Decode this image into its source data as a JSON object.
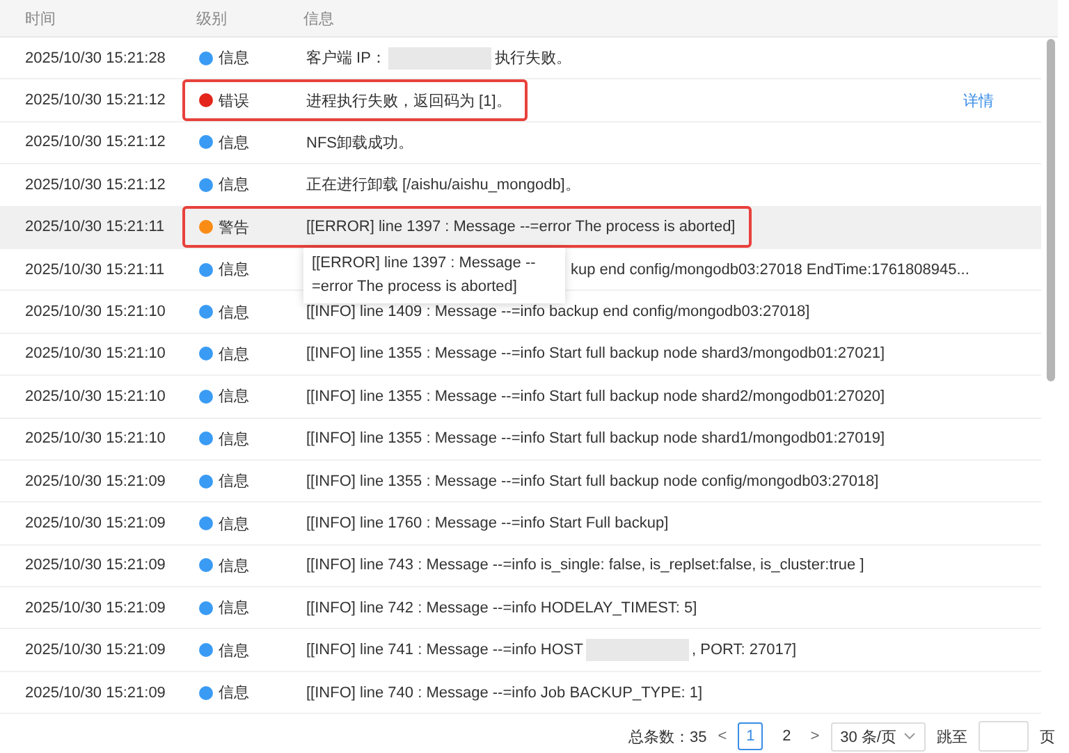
{
  "table": {
    "columns": [
      "时间",
      "级别",
      "信息"
    ],
    "rows": [
      {
        "time": "2025/10/30 15:21:28",
        "level": "信息",
        "kind": "info",
        "message": "客户端 IP：",
        "redacted": true,
        "message_after": "执行失败。",
        "highlighted": false,
        "hovered": false
      },
      {
        "time": "2025/10/30 15:21:12",
        "level": "错误",
        "kind": "error",
        "message": "进程执行失败，返回码为 [1]。",
        "highlighted": true,
        "hovered": false,
        "link": "详情"
      },
      {
        "time": "2025/10/30 15:21:12",
        "level": "信息",
        "kind": "info",
        "message": "NFS卸载成功。",
        "highlighted": false,
        "hovered": false
      },
      {
        "time": "2025/10/30 15:21:12",
        "level": "信息",
        "kind": "info",
        "message": "正在进行卸载 [/aishu/aishu_mongodb]。",
        "highlighted": false,
        "hovered": false
      },
      {
        "time": "2025/10/30 15:21:11",
        "level": "警告",
        "kind": "warning",
        "message": "[[ERROR] line 1397 : Message --=error The process is aborted]",
        "highlighted": true,
        "hovered": true
      },
      {
        "time": "2025/10/30 15:21:11",
        "level": "信息",
        "kind": "info",
        "message": "kup end config/mongodb03:27018 EndTime:1761808945...",
        "covered": true,
        "highlighted": false,
        "hovered": false
      },
      {
        "time": "2025/10/30 15:21:10",
        "level": "信息",
        "kind": "info",
        "message": "[[INFO] line 1409 : Message --=info backup end config/mongodb03:27018]",
        "highlighted": false,
        "hovered": false
      },
      {
        "time": "2025/10/30 15:21:10",
        "level": "信息",
        "kind": "info",
        "message": "[[INFO] line 1355 : Message --=info Start full backup node shard3/mongodb01:27021]",
        "highlighted": false,
        "hovered": false
      },
      {
        "time": "2025/10/30 15:21:10",
        "level": "信息",
        "kind": "info",
        "message": "[[INFO] line 1355 : Message --=info Start full backup node shard2/mongodb01:27020]",
        "highlighted": false,
        "hovered": false
      },
      {
        "time": "2025/10/30 15:21:10",
        "level": "信息",
        "kind": "info",
        "message": "[[INFO] line 1355 : Message --=info Start full backup node shard1/mongodb01:27019]",
        "highlighted": false,
        "hovered": false
      },
      {
        "time": "2025/10/30 15:21:09",
        "level": "信息",
        "kind": "info",
        "message": "[[INFO] line 1355 : Message --=info Start full backup node config/mongodb03:27018]",
        "highlighted": false,
        "hovered": false
      },
      {
        "time": "2025/10/30 15:21:09",
        "level": "信息",
        "kind": "info",
        "message": "[[INFO] line 1760 : Message --=info Start Full backup]",
        "highlighted": false,
        "hovered": false
      },
      {
        "time": "2025/10/30 15:21:09",
        "level": "信息",
        "kind": "info",
        "message": "[[INFO] line 743 : Message --=info is_single: false, is_replset:false, is_cluster:true ]",
        "highlighted": false,
        "hovered": false
      },
      {
        "time": "2025/10/30 15:21:09",
        "level": "信息",
        "kind": "info",
        "message": "[[INFO] line 742 : Message --=info HODELAY_TIMEST: 5]",
        "highlighted": false,
        "hovered": false
      },
      {
        "time": "2025/10/30 15:21:09",
        "level": "信息",
        "kind": "info",
        "message": "[[INFO] line 741 : Message --=info HOST",
        "redacted": true,
        "message_after": ", PORT: 27017]",
        "highlighted": false,
        "hovered": false
      },
      {
        "time": "2025/10/30 15:21:09",
        "level": "信息",
        "kind": "info",
        "message": "[[INFO] line 740 : Message --=info Job BACKUP_TYPE: 1]",
        "highlighted": false,
        "hovered": false
      }
    ]
  },
  "tooltip": {
    "text": "[[ERROR] line 1397 : Message --=error The process is aborted]"
  },
  "pagination": {
    "total": "总条数：35",
    "prev": "<",
    "pages": [
      {
        "label": "1",
        "selected": true
      },
      {
        "label": "2",
        "selected": false
      }
    ],
    "next": ">",
    "page_size": "30 条/页",
    "jump_label": "跳至",
    "page_unit": "页"
  }
}
